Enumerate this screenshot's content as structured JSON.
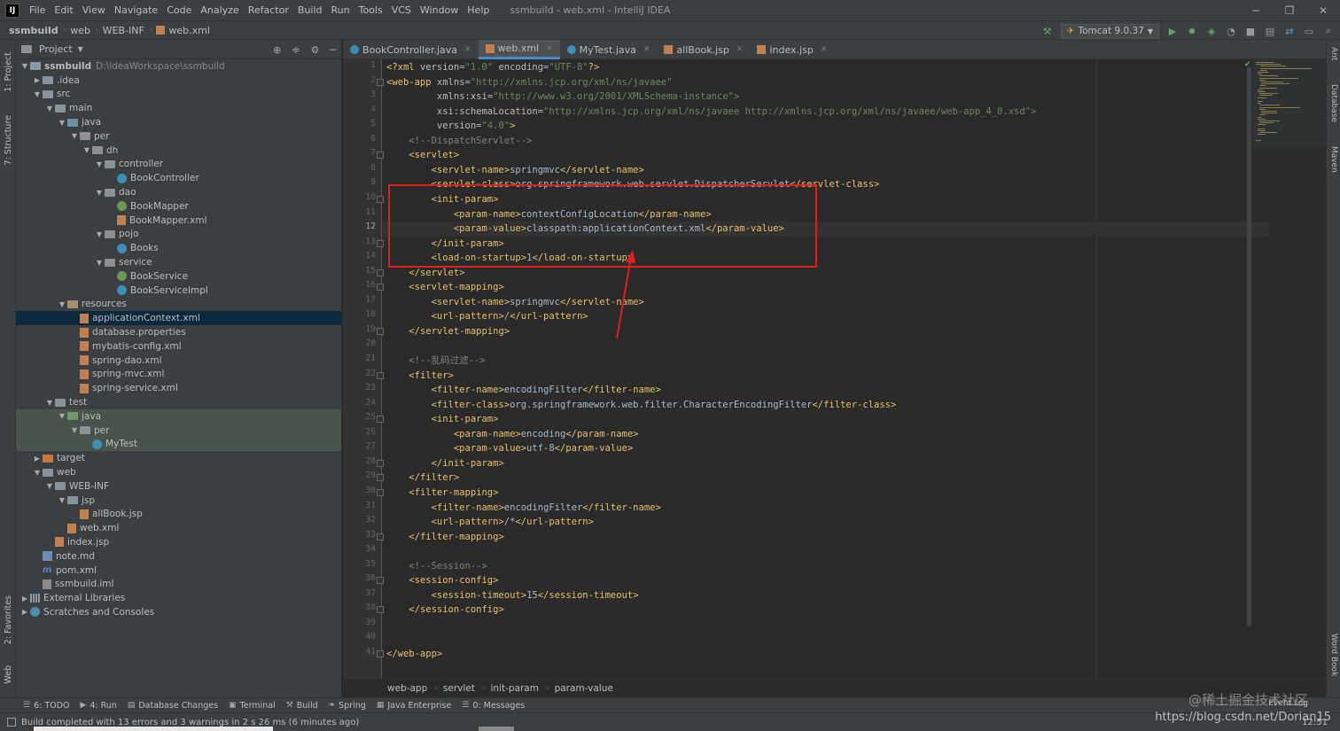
{
  "app": {
    "title": "ssmbuild - web.xml - IntelliJ IDEA",
    "logo": "IJ",
    "menu": [
      "File",
      "Edit",
      "View",
      "Navigate",
      "Code",
      "Analyze",
      "Refactor",
      "Build",
      "Run",
      "Tools",
      "VCS",
      "Window",
      "Help"
    ]
  },
  "breadcrumb": [
    "ssmbuild",
    "web",
    "WEB-INF",
    "web.xml"
  ],
  "run_config": "Tomcat 9.0.37",
  "left_strip": [
    "1: Project",
    "7: Structure",
    "2: Favorites",
    "Web"
  ],
  "right_strip": [
    "Ant",
    "Database",
    "Maven",
    "Word Book"
  ],
  "project_panel": {
    "title": "Project",
    "tree": [
      {
        "label": "ssmbuild",
        "hint": "D:\\ideaWorkspace\\ssmbuild",
        "depth": 0,
        "arrow": "down",
        "icon": "module",
        "bold": true
      },
      {
        "label": ".idea",
        "depth": 1,
        "arrow": "right",
        "icon": "folder"
      },
      {
        "label": "src",
        "depth": 1,
        "arrow": "down",
        "icon": "folder"
      },
      {
        "label": "main",
        "depth": 2,
        "arrow": "down",
        "icon": "folder"
      },
      {
        "label": "java",
        "depth": 3,
        "arrow": "down",
        "icon": "src"
      },
      {
        "label": "per",
        "depth": 4,
        "arrow": "down",
        "icon": "folder"
      },
      {
        "label": "dh",
        "depth": 5,
        "arrow": "down",
        "icon": "folder"
      },
      {
        "label": "controller",
        "depth": 6,
        "arrow": "down",
        "icon": "folder"
      },
      {
        "label": "BookController",
        "depth": 7,
        "icon": "class"
      },
      {
        "label": "dao",
        "depth": 6,
        "arrow": "down",
        "icon": "folder"
      },
      {
        "label": "BookMapper",
        "depth": 7,
        "icon": "interface"
      },
      {
        "label": "BookMapper.xml",
        "depth": 7,
        "icon": "xml"
      },
      {
        "label": "pojo",
        "depth": 6,
        "arrow": "down",
        "icon": "folder"
      },
      {
        "label": "Books",
        "depth": 7,
        "icon": "class"
      },
      {
        "label": "service",
        "depth": 6,
        "arrow": "down",
        "icon": "folder"
      },
      {
        "label": "BookService",
        "depth": 7,
        "icon": "interface"
      },
      {
        "label": "BookServiceImpl",
        "depth": 7,
        "icon": "class"
      },
      {
        "label": "resources",
        "depth": 3,
        "arrow": "down",
        "icon": "res"
      },
      {
        "label": "applicationContext.xml",
        "depth": 4,
        "icon": "xml",
        "selected": true
      },
      {
        "label": "database.properties",
        "depth": 4,
        "icon": "xml"
      },
      {
        "label": "mybatis-config.xml",
        "depth": 4,
        "icon": "xml"
      },
      {
        "label": "spring-dao.xml",
        "depth": 4,
        "icon": "xml"
      },
      {
        "label": "spring-mvc.xml",
        "depth": 4,
        "icon": "xml"
      },
      {
        "label": "spring-service.xml",
        "depth": 4,
        "icon": "xml"
      },
      {
        "label": "test",
        "depth": 2,
        "arrow": "down",
        "icon": "folder"
      },
      {
        "label": "java",
        "depth": 3,
        "arrow": "down",
        "icon": "green",
        "test": true
      },
      {
        "label": "per",
        "depth": 4,
        "arrow": "down",
        "icon": "folder",
        "test": true
      },
      {
        "label": "MyTest",
        "depth": 5,
        "icon": "class",
        "test": true
      },
      {
        "label": "target",
        "depth": 1,
        "arrow": "right",
        "icon": "orange"
      },
      {
        "label": "web",
        "depth": 1,
        "arrow": "down",
        "icon": "folder"
      },
      {
        "label": "WEB-INF",
        "depth": 2,
        "arrow": "down",
        "icon": "folder"
      },
      {
        "label": "jsp",
        "depth": 3,
        "arrow": "down",
        "icon": "folder"
      },
      {
        "label": "allBook.jsp",
        "depth": 4,
        "icon": "xml"
      },
      {
        "label": "web.xml",
        "depth": 3,
        "icon": "xml"
      },
      {
        "label": "index.jsp",
        "depth": 2,
        "icon": "xml"
      },
      {
        "label": "note.md",
        "depth": 1,
        "icon": "md"
      },
      {
        "label": "pom.xml",
        "depth": 1,
        "icon": "m"
      },
      {
        "label": "ssmbuild.iml",
        "depth": 1,
        "icon": "props"
      },
      {
        "label": "External Libraries",
        "depth": 0,
        "arrow": "right",
        "icon": "lib"
      },
      {
        "label": "Scratches and Consoles",
        "depth": 0,
        "arrow": "right",
        "icon": "scratch"
      }
    ]
  },
  "editor_tabs": [
    {
      "label": "BookController.java",
      "icon": "java"
    },
    {
      "label": "web.xml",
      "icon": "xml",
      "active": true
    },
    {
      "label": "MyTest.java",
      "icon": "java"
    },
    {
      "label": "allBook.jsp",
      "icon": "xml"
    },
    {
      "label": "index.jsp",
      "icon": "xml"
    }
  ],
  "editor": {
    "current_line": 12,
    "lines": [
      "<?xml version=\"1.0\" encoding=\"UTF-8\"?>",
      "<web-app xmlns=\"http://xmlns.jcp.org/xml/ns/javaee\"",
      "         xmlns:xsi=\"http://www.w3.org/2001/XMLSchema-instance\"",
      "         xsi:schemaLocation=\"http://xmlns.jcp.org/xml/ns/javaee http://xmlns.jcp.org/xml/ns/javaee/web-app_4_0.xsd\"",
      "         version=\"4.0\">",
      "    <!--DispatchServlet-->",
      "    <servlet>",
      "        <servlet-name>springmvc</servlet-name>",
      "        <servlet-class>org.springframework.web.servlet.DispatcherServlet</servlet-class>",
      "        <init-param>",
      "            <param-name>contextConfigLocation</param-name>",
      "            <param-value>classpath:applicationContext.xml</param-value>",
      "        </init-param>",
      "        <load-on-startup>1</load-on-startup>",
      "    </servlet>",
      "    <servlet-mapping>",
      "        <servlet-name>springmvc</servlet-name>",
      "        <url-pattern>/</url-pattern>",
      "    </servlet-mapping>",
      "",
      "    <!--乱码过滤-->",
      "    <filter>",
      "        <filter-name>encodingFilter</filter-name>",
      "        <filter-class>org.springframework.web.filter.CharacterEncodingFilter</filter-class>",
      "        <init-param>",
      "            <param-name>encoding</param-name>",
      "            <param-value>utf-8</param-value>",
      "        </init-param>",
      "    </filter>",
      "    <filter-mapping>",
      "        <filter-name>encodingFilter</filter-name>",
      "        <url-pattern>/*</url-pattern>",
      "    </filter-mapping>",
      "",
      "    <!--Session-->",
      "    <session-config>",
      "        <session-timeout>15</session-timeout>",
      "    </session-config>",
      "",
      "",
      "</web-app>"
    ],
    "fold_lines": [
      2,
      7,
      10,
      13,
      15,
      16,
      19,
      22,
      25,
      28,
      29,
      30,
      33,
      36,
      38,
      41
    ]
  },
  "editor_breadcrumb": [
    "web-app",
    "servlet",
    "init-param",
    "param-value"
  ],
  "bottom_tabs": [
    {
      "label": "6: TODO",
      "icon": "☰"
    },
    {
      "label": "4: Run",
      "icon": "▶"
    },
    {
      "label": "Database Changes",
      "icon": "▤"
    },
    {
      "label": "Terminal",
      "icon": "▣"
    },
    {
      "label": "Build",
      "icon": "⚒"
    },
    {
      "label": "Spring",
      "icon": "❧"
    },
    {
      "label": "Java Enterprise",
      "icon": "▦"
    },
    {
      "label": "0: Messages",
      "icon": "☰"
    }
  ],
  "status": {
    "text": "Build completed with 13 errors and 3 warnings in 2 s 26 ms (6 minutes ago)",
    "position": "12:51",
    "event_log": "Event Log"
  },
  "watermark": "@稀土掘金技术社区",
  "watermark_url": "https://blog.csdn.net/Dorian15",
  "colors": {
    "accent": "#4a88c7",
    "annotation": "#e02020",
    "selection": "#0d293e",
    "run_green": "#59a869"
  }
}
